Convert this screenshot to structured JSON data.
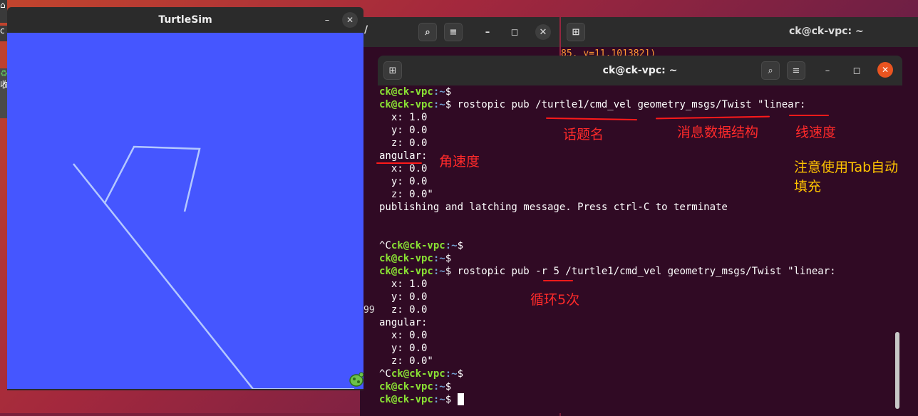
{
  "turtlesim": {
    "title": "TurtleSim",
    "minimize_glyph": "–",
    "close_glyph": "✕",
    "background_color": "#4556ff",
    "path_color": "#b4c8ff"
  },
  "background_terminal_1": {
    "title_fragment": "/"
  },
  "background_terminal_2": {
    "title": "ck@ck-vpc: ~",
    "partial_output": "85, y=11.101382])"
  },
  "side_fragment": "99",
  "dock_fragments": [
    "c",
    "收"
  ],
  "terminal": {
    "title": "ck@ck-vpc: ~",
    "new_tab_icon": "new-tab-icon",
    "search_icon": "search-icon",
    "menu_icon": "hamburger-menu-icon",
    "minimize_glyph": "–",
    "maximize_glyph": "◻",
    "close_glyph": "✕",
    "prompt_user": "ck@ck-vpc",
    "prompt_path": ":~",
    "prompt_symbol": "$",
    "lines": [
      "",
      " rostopic pub /turtle1/cmd_vel geometry_msgs/Twist \"linear:",
      "  x: 1.0",
      "  y: 0.0",
      "  z: 0.0",
      "angular:",
      "  x: 0.0",
      "  y: 0.0",
      "  z: 0.0\"",
      "publishing and latching message. Press ctrl-C to terminate",
      "",
      "",
      "^C",
      "",
      " rostopic pub -r 5 /turtle1/cmd_vel geometry_msgs/Twist \"linear:",
      "  x: 1.0",
      "  y: 0.0",
      "  z: 0.0",
      "angular:",
      "  x: 0.0",
      "  y: 0.0",
      "  z: 0.0\"",
      "^C",
      "",
      " "
    ]
  },
  "annotations": {
    "topic_name": "话题名",
    "message_type": "消息数据结构",
    "linear_velocity": "线速度",
    "angular_velocity": "角速度",
    "tab_hint_line1": "注意使用Tab自动",
    "tab_hint_line2": "填充",
    "repeat_5": "循环5次"
  }
}
